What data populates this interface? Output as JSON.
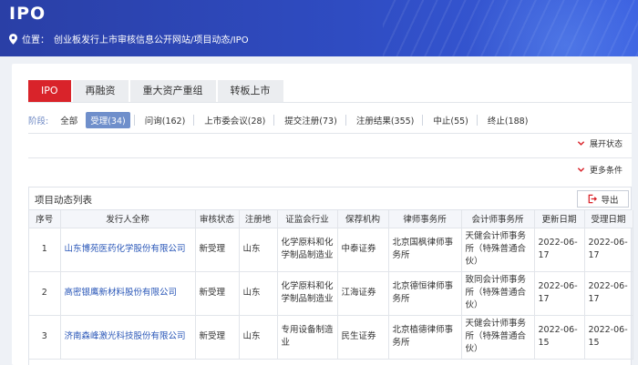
{
  "header": {
    "title": "IPO",
    "breadcrumb_prefix": "位置：",
    "breadcrumb_path": "创业板发行上市审核信息公开网站/项目动态/IPO"
  },
  "tabs": [
    {
      "label": "IPO",
      "active": true
    },
    {
      "label": "再融资",
      "active": false
    },
    {
      "label": "重大资产重组",
      "active": false
    },
    {
      "label": "转板上市",
      "active": false
    }
  ],
  "stages": {
    "label": "阶段:",
    "items": [
      {
        "label": "全部",
        "active": false
      },
      {
        "label": "受理(34)",
        "active": true
      },
      {
        "label": "问询(162)",
        "active": false
      },
      {
        "label": "上市委会议(28)",
        "active": false
      },
      {
        "label": "提交注册(73)",
        "active": false
      },
      {
        "label": "注册结果(355)",
        "active": false
      },
      {
        "label": "中止(55)",
        "active": false
      },
      {
        "label": "终止(188)",
        "active": false
      }
    ]
  },
  "filters": {
    "expand_status": "展开状态",
    "more_conditions": "更多条件"
  },
  "table": {
    "title": "项目动态列表",
    "export_label": "导出",
    "columns": [
      "序号",
      "发行人全称",
      "审核状态",
      "注册地",
      "证监会行业",
      "保荐机构",
      "律师事务所",
      "会计师事务所",
      "更新日期",
      "受理日期"
    ],
    "rows": [
      {
        "no": "1",
        "name": "山东博苑医药化学股份有限公司",
        "status": "新受理",
        "region": "山东",
        "industry": "化学原料和化学制品制造业",
        "sponsor": "中泰证券",
        "law": "北京国枫律师事务所",
        "accounting": "天健会计师事务所（特殊普通合伙）",
        "updated": "2022-06-17",
        "accepted": "2022-06-17"
      },
      {
        "no": "2",
        "name": "高密银鹰新材料股份有限公司",
        "status": "新受理",
        "region": "山东",
        "industry": "化学原料和化学制品制造业",
        "sponsor": "江海证券",
        "law": "北京德恒律师事务所",
        "accounting": "致同会计师事务所（特殊普通合伙）",
        "updated": "2022-06-17",
        "accepted": "2022-06-17"
      },
      {
        "no": "3",
        "name": "济南森峰激光科技股份有限公司",
        "status": "新受理",
        "region": "山东",
        "industry": "专用设备制造业",
        "sponsor": "民生证券",
        "law": "北京植德律师事务所",
        "accounting": "天健会计师事务所（特殊普通合伙）",
        "updated": "2022-06-15",
        "accepted": "2022-06-15"
      }
    ]
  },
  "colors": {
    "accent_red": "#d9232a",
    "banner_blue": "#2f4cc2",
    "stage_active": "#6f8fcb",
    "link_blue": "#2a57b8"
  },
  "icons": {
    "location": "map-pin-icon",
    "chevron": "chevron-down-icon",
    "export": "export-icon"
  }
}
